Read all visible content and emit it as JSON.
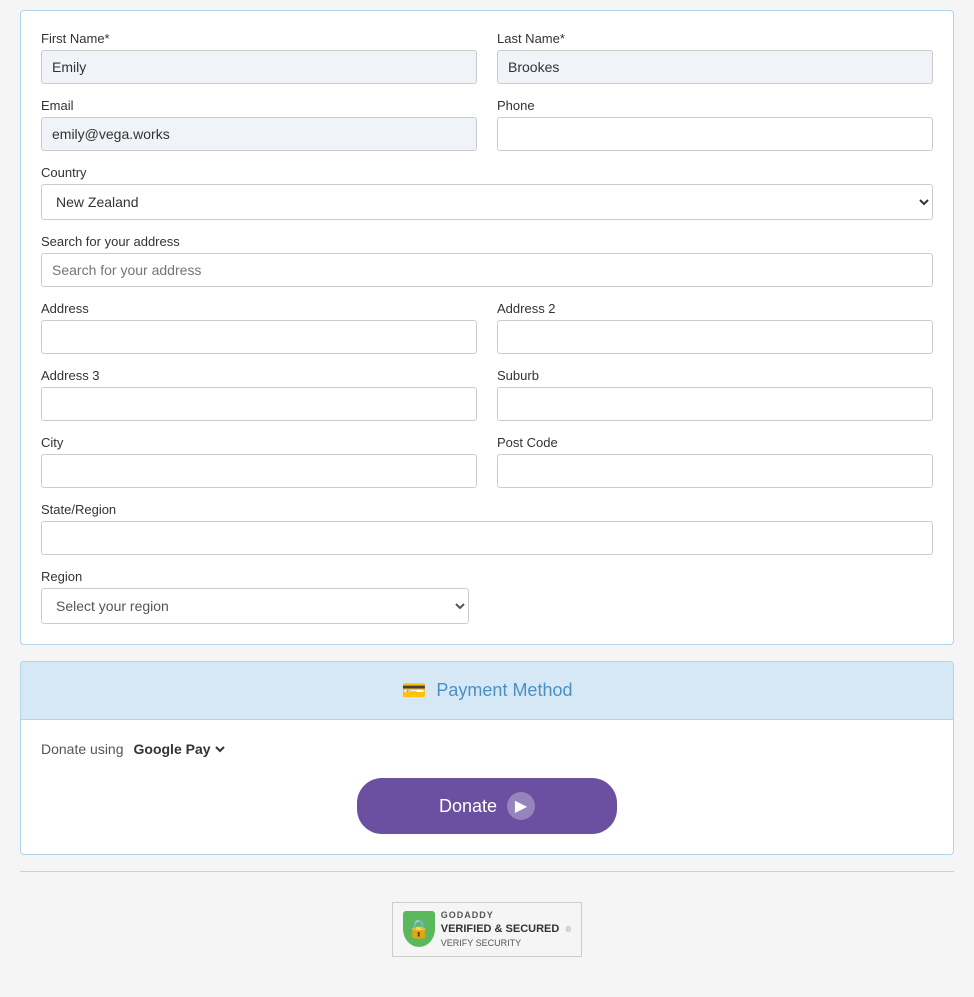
{
  "form": {
    "first_name_label": "First Name*",
    "first_name_value": "Emily",
    "last_name_label": "Last Name*",
    "last_name_value": "Brookes",
    "email_label": "Email",
    "email_value": "emily@vega.works",
    "phone_label": "Phone",
    "phone_value": "",
    "country_label": "Country",
    "country_value": "New Zealand",
    "search_address_label": "Search for your address",
    "search_address_placeholder": "Search for your address",
    "address_label": "Address",
    "address2_label": "Address 2",
    "address3_label": "Address 3",
    "suburb_label": "Suburb",
    "city_label": "City",
    "postcode_label": "Post Code",
    "state_region_label": "State/Region",
    "region_label": "Region",
    "region_placeholder": "Select your region"
  },
  "payment": {
    "section_title": "Payment Method",
    "donate_using_label": "Donate using",
    "payment_method": "Google Pay",
    "donate_button_label": "Donate"
  },
  "badge": {
    "godaddy_top": "GODADDY",
    "godaddy_main": "VERIFIED & SECURED",
    "godaddy_sub": "VERIFY SECURITY",
    "copyright": "®"
  }
}
